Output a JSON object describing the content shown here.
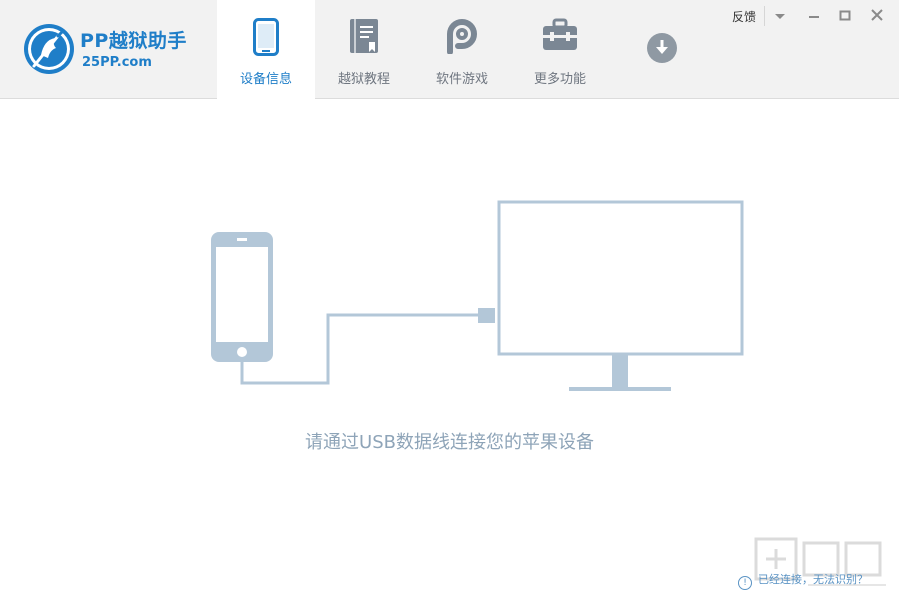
{
  "app": {
    "name": "PP越狱助手",
    "url": "25PP.com"
  },
  "tabs": [
    {
      "label": "设备信息",
      "icon": "phone-icon",
      "active": true
    },
    {
      "label": "越狱教程",
      "icon": "book-icon",
      "active": false
    },
    {
      "label": "软件游戏",
      "icon": "pp-icon",
      "active": false
    },
    {
      "label": "更多功能",
      "icon": "toolbox-icon",
      "active": false
    }
  ],
  "window": {
    "feedback_label": "反馈",
    "icons": [
      "dropdown-icon",
      "minimize-icon",
      "maximize-icon",
      "close-icon"
    ]
  },
  "main": {
    "connect_message": "请通过USB数据线连接您的苹果设备"
  },
  "help": {
    "label": "已经连接，无法识别？"
  },
  "colors": {
    "accent": "#1f7ec8",
    "illustration": "#b3c7d8",
    "message": "#8ea4b8"
  }
}
